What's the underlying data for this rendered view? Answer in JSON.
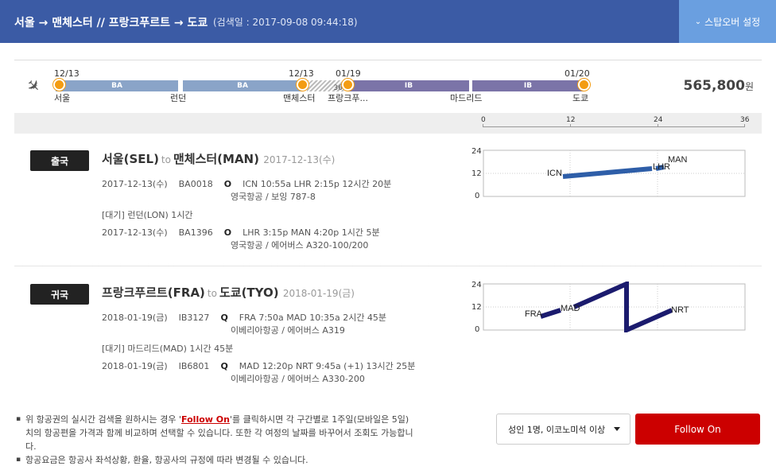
{
  "header": {
    "route": "서울 → 맨체스터 // 프랑크푸르트 → 도쿄",
    "searched": "(검색일 : 2017-09-08 09:44:18)",
    "stopover_label": "스탑오버 설정"
  },
  "timeline": {
    "segments": [
      "BA",
      "BA",
      "36",
      "IB",
      "IB"
    ],
    "dates": [
      "12/13",
      "12/13",
      "01/19",
      "01/20"
    ],
    "cities": [
      "서울",
      "런던",
      "맨체스터",
      "프랑크푸...",
      "마드리드",
      "도쿄"
    ],
    "price": "565,800",
    "currency": "원"
  },
  "axis": {
    "ticks": [
      "0",
      "12",
      "24",
      "36"
    ]
  },
  "outbound": {
    "badge": "출국",
    "from": "서울(SEL)",
    "to_word": "to",
    "to": "맨체스터(MAN)",
    "date": "2017-12-13(수)",
    "flight1": {
      "date": "2017-12-13(수)",
      "no": "BA0018",
      "cls": "O",
      "detail": "ICN 10:55a LHR 2:15p   12시간 20분",
      "sub": "영국항공 / 보잉 787-8"
    },
    "wait": "[대기] 런던(LON)   1시간",
    "flight2": {
      "date": "2017-12-13(수)",
      "no": "BA1396",
      "cls": "O",
      "detail": "LHR 3:15p MAN 4:20p   1시간 5분",
      "sub": "영국항공 / 에어버스 A320-100/200"
    }
  },
  "inbound": {
    "badge": "귀국",
    "from": "프랑크푸르트(FRA)",
    "to_word": "to",
    "to": "도쿄(TYO)",
    "date": "2018-01-19(금)",
    "flight1": {
      "date": "2018-01-19(금)",
      "no": "IB3127",
      "cls": "Q",
      "detail": "FRA 7:50a MAD 10:35a   2시간 45분",
      "sub": "이베리아항공 / 에어버스 A319"
    },
    "wait": "[대기] 마드리드(MAD)   1시간 45분",
    "flight2": {
      "date": "2018-01-19(금)",
      "no": "IB6801",
      "cls": "Q",
      "detail": "MAD 12:20p NRT 9:45a (+1)   13시간 25분",
      "sub": "이베리아항공 / 에어버스 A330-200"
    }
  },
  "chart_data": [
    {
      "type": "line",
      "ylim": [
        0,
        24
      ],
      "yticks": [
        "24",
        "12",
        "0"
      ],
      "airports": [
        "ICN",
        "LHR",
        "MAN"
      ],
      "color": "#2e5ea8"
    },
    {
      "type": "line",
      "ylim": [
        0,
        24
      ],
      "yticks": [
        "24",
        "12",
        "0"
      ],
      "airports": [
        "FRA",
        "MAD",
        "NRT"
      ],
      "color": "#1b1b6e"
    }
  ],
  "notes": {
    "n1_pre": "위 항공권의 실시간 검색을 원하시는 경우 '",
    "n1_link": "Follow On",
    "n1_post": "'를 클릭하시면 각 구간별로 1주일(모바일은 5일)치의 항공편을 가격과 함께 비교하며 선택할 수 있습니다. 또한 각 여정의 날짜를 바꾸어서 조회도 가능합니다.",
    "n2": "항공요금은 항공사 좌석상황, 환율, 항공사의 규정에 따라 변경될 수 있습니다."
  },
  "controls": {
    "passenger_select": "성인 1명, 이코노미석 이상",
    "follow_button": "Follow On"
  }
}
